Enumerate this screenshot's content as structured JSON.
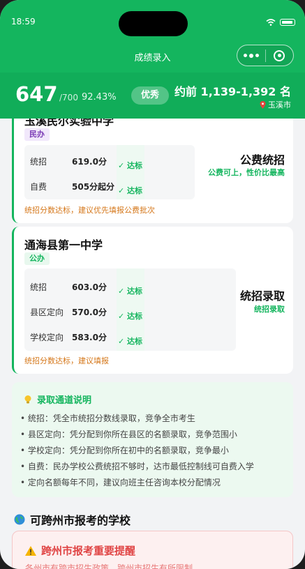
{
  "status_bar": {
    "time": "18:59"
  },
  "navbar": {
    "title": "成绩录入"
  },
  "score_summary": {
    "score": "647",
    "total": "/700",
    "percent": "92.43%",
    "level": "优秀",
    "rank": "约前 1,139-1,392 名",
    "city": "玉溪市"
  },
  "schools": [
    {
      "name": "玉溪民尔实验中学",
      "type_tag": "民办",
      "rows": [
        {
          "label": "统招",
          "value": "619.0分",
          "status": "✓ 达标"
        },
        {
          "label": "自费",
          "value": "505分起分",
          "status": "✓ 达标"
        }
      ],
      "result": "公费统招",
      "result_sub": "公费可上，性价比最高",
      "advice": "统招分数达标，建议优先填报公费批次"
    },
    {
      "name": "通海县第一中学",
      "type_tag": "公办",
      "rows": [
        {
          "label": "统招",
          "value": "603.0分",
          "status": "✓ 达标"
        },
        {
          "label": "县区定向",
          "value": "570.0分",
          "status": "✓ 达标"
        },
        {
          "label": "学校定向",
          "value": "583.0分",
          "status": "✓ 达标"
        }
      ],
      "result": "统招录取",
      "result_sub": "统招录取",
      "advice": "统招分数达标，建议填报"
    }
  ],
  "admission_info": {
    "title": "录取通道说明",
    "lines": [
      "• 统招：凭全市统招分数线录取，竞争全市考生",
      "• 县区定向：凭分配到你所在县区的名额录取，竞争范围小",
      "• 学校定向：凭分配到你所在初中的名额录取，竞争最小",
      "• 自费：民办学校公费统招不够时，达市最低控制线可自费入学",
      "• 定向名额每年不同，建议向班主任咨询本校分配情况"
    ]
  },
  "cross_city": {
    "title": "可跨州市报考的学校",
    "warning_title": "跨州市报考重要提醒",
    "warning_text": "各州市有跨市招生政策，跨州市招生有所限制"
  },
  "colors": {
    "brand_green": "#14b55e",
    "warning_red": "#e04545",
    "advice_orange": "#d5771a"
  }
}
